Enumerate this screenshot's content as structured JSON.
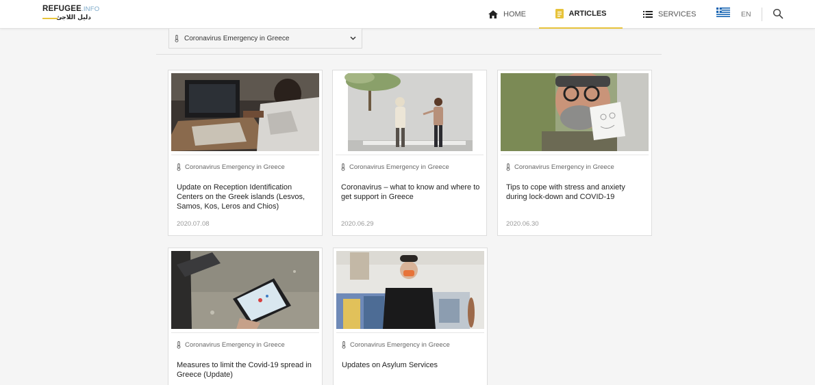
{
  "header": {
    "logo": {
      "text_main": "REFUGEE",
      "text_suffix": ".INFO",
      "text_arabic": "دليل اللاجئ"
    },
    "nav": [
      {
        "label": "HOME",
        "icon": "home-icon"
      },
      {
        "label": "ARTICLES",
        "icon": "article-icon",
        "active": true
      },
      {
        "label": "SERVICES",
        "icon": "list-icon"
      }
    ],
    "language": "EN",
    "flag": "greece-flag-icon",
    "search_icon": "search-icon"
  },
  "category_select": {
    "selected": "Coronavirus Emergency in Greece",
    "icon": "thermometer-icon"
  },
  "articles": [
    {
      "category": "Coronavirus Emergency in Greece",
      "title": "Update on Reception Identification Centers on the Greek islands (Lesvos, Samos, Kos, Leros and Chios)",
      "date": "2020.07.08"
    },
    {
      "category": "Coronavirus Emergency in Greece",
      "title": "Coronavirus – what to know and where to get support in Greece",
      "date": "2020.06.29"
    },
    {
      "category": "Coronavirus Emergency in Greece",
      "title": "Tips to cope with stress and anxiety during lock-down and COVID-19",
      "date": "2020.06.30"
    },
    {
      "category": "Coronavirus Emergency in Greece",
      "title": "Measures to limit the Covid-19 spread in Greece (Update)"
    },
    {
      "category": "Coronavirus Emergency in Greece",
      "title": "Updates on Asylum Services"
    }
  ],
  "colors": {
    "accent": "#e7c33a",
    "background": "#f5f5f5",
    "card": "#ffffff"
  }
}
